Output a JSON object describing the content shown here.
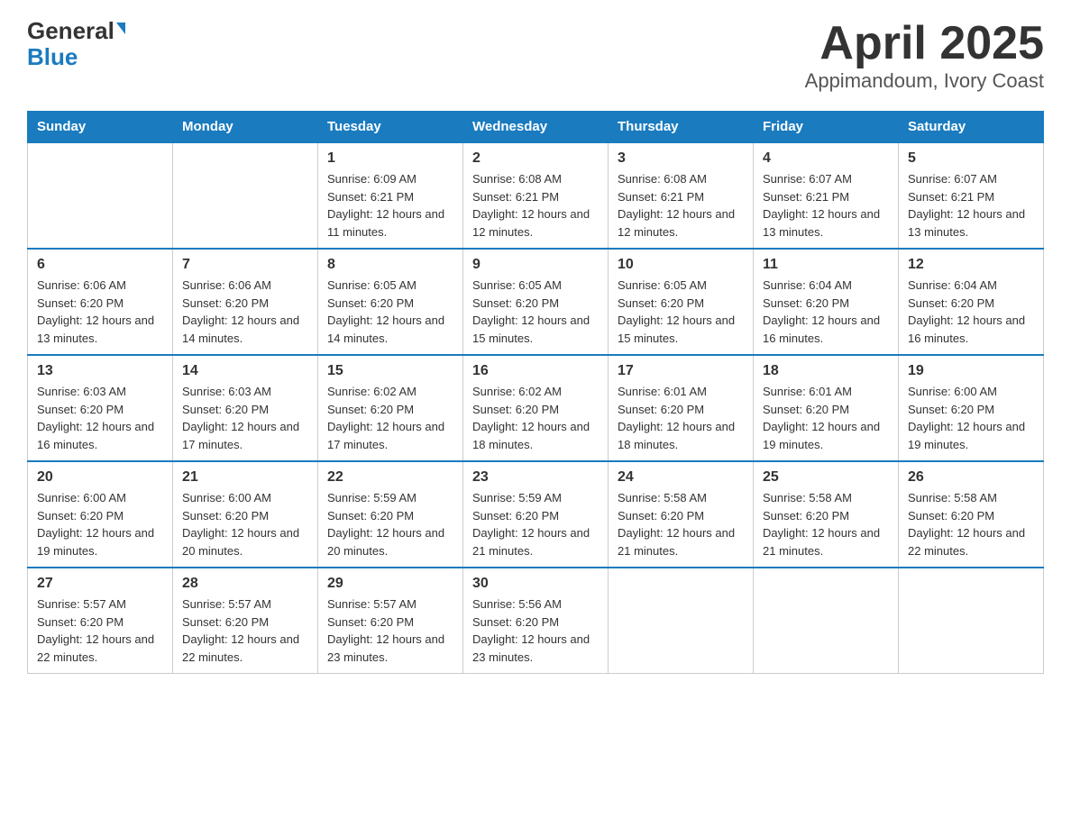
{
  "header": {
    "title": "April 2025",
    "subtitle": "Appimandoum, Ivory Coast",
    "logo_general": "General",
    "logo_blue": "Blue"
  },
  "days_of_week": [
    "Sunday",
    "Monday",
    "Tuesday",
    "Wednesday",
    "Thursday",
    "Friday",
    "Saturday"
  ],
  "weeks": [
    [
      {
        "day": "",
        "info": ""
      },
      {
        "day": "",
        "info": ""
      },
      {
        "day": "1",
        "info": "Sunrise: 6:09 AM\nSunset: 6:21 PM\nDaylight: 12 hours and 11 minutes."
      },
      {
        "day": "2",
        "info": "Sunrise: 6:08 AM\nSunset: 6:21 PM\nDaylight: 12 hours and 12 minutes."
      },
      {
        "day": "3",
        "info": "Sunrise: 6:08 AM\nSunset: 6:21 PM\nDaylight: 12 hours and 12 minutes."
      },
      {
        "day": "4",
        "info": "Sunrise: 6:07 AM\nSunset: 6:21 PM\nDaylight: 12 hours and 13 minutes."
      },
      {
        "day": "5",
        "info": "Sunrise: 6:07 AM\nSunset: 6:21 PM\nDaylight: 12 hours and 13 minutes."
      }
    ],
    [
      {
        "day": "6",
        "info": "Sunrise: 6:06 AM\nSunset: 6:20 PM\nDaylight: 12 hours and 13 minutes."
      },
      {
        "day": "7",
        "info": "Sunrise: 6:06 AM\nSunset: 6:20 PM\nDaylight: 12 hours and 14 minutes."
      },
      {
        "day": "8",
        "info": "Sunrise: 6:05 AM\nSunset: 6:20 PM\nDaylight: 12 hours and 14 minutes."
      },
      {
        "day": "9",
        "info": "Sunrise: 6:05 AM\nSunset: 6:20 PM\nDaylight: 12 hours and 15 minutes."
      },
      {
        "day": "10",
        "info": "Sunrise: 6:05 AM\nSunset: 6:20 PM\nDaylight: 12 hours and 15 minutes."
      },
      {
        "day": "11",
        "info": "Sunrise: 6:04 AM\nSunset: 6:20 PM\nDaylight: 12 hours and 16 minutes."
      },
      {
        "day": "12",
        "info": "Sunrise: 6:04 AM\nSunset: 6:20 PM\nDaylight: 12 hours and 16 minutes."
      }
    ],
    [
      {
        "day": "13",
        "info": "Sunrise: 6:03 AM\nSunset: 6:20 PM\nDaylight: 12 hours and 16 minutes."
      },
      {
        "day": "14",
        "info": "Sunrise: 6:03 AM\nSunset: 6:20 PM\nDaylight: 12 hours and 17 minutes."
      },
      {
        "day": "15",
        "info": "Sunrise: 6:02 AM\nSunset: 6:20 PM\nDaylight: 12 hours and 17 minutes."
      },
      {
        "day": "16",
        "info": "Sunrise: 6:02 AM\nSunset: 6:20 PM\nDaylight: 12 hours and 18 minutes."
      },
      {
        "day": "17",
        "info": "Sunrise: 6:01 AM\nSunset: 6:20 PM\nDaylight: 12 hours and 18 minutes."
      },
      {
        "day": "18",
        "info": "Sunrise: 6:01 AM\nSunset: 6:20 PM\nDaylight: 12 hours and 19 minutes."
      },
      {
        "day": "19",
        "info": "Sunrise: 6:00 AM\nSunset: 6:20 PM\nDaylight: 12 hours and 19 minutes."
      }
    ],
    [
      {
        "day": "20",
        "info": "Sunrise: 6:00 AM\nSunset: 6:20 PM\nDaylight: 12 hours and 19 minutes."
      },
      {
        "day": "21",
        "info": "Sunrise: 6:00 AM\nSunset: 6:20 PM\nDaylight: 12 hours and 20 minutes."
      },
      {
        "day": "22",
        "info": "Sunrise: 5:59 AM\nSunset: 6:20 PM\nDaylight: 12 hours and 20 minutes."
      },
      {
        "day": "23",
        "info": "Sunrise: 5:59 AM\nSunset: 6:20 PM\nDaylight: 12 hours and 21 minutes."
      },
      {
        "day": "24",
        "info": "Sunrise: 5:58 AM\nSunset: 6:20 PM\nDaylight: 12 hours and 21 minutes."
      },
      {
        "day": "25",
        "info": "Sunrise: 5:58 AM\nSunset: 6:20 PM\nDaylight: 12 hours and 21 minutes."
      },
      {
        "day": "26",
        "info": "Sunrise: 5:58 AM\nSunset: 6:20 PM\nDaylight: 12 hours and 22 minutes."
      }
    ],
    [
      {
        "day": "27",
        "info": "Sunrise: 5:57 AM\nSunset: 6:20 PM\nDaylight: 12 hours and 22 minutes."
      },
      {
        "day": "28",
        "info": "Sunrise: 5:57 AM\nSunset: 6:20 PM\nDaylight: 12 hours and 22 minutes."
      },
      {
        "day": "29",
        "info": "Sunrise: 5:57 AM\nSunset: 6:20 PM\nDaylight: 12 hours and 23 minutes."
      },
      {
        "day": "30",
        "info": "Sunrise: 5:56 AM\nSunset: 6:20 PM\nDaylight: 12 hours and 23 minutes."
      },
      {
        "day": "",
        "info": ""
      },
      {
        "day": "",
        "info": ""
      },
      {
        "day": "",
        "info": ""
      }
    ]
  ]
}
